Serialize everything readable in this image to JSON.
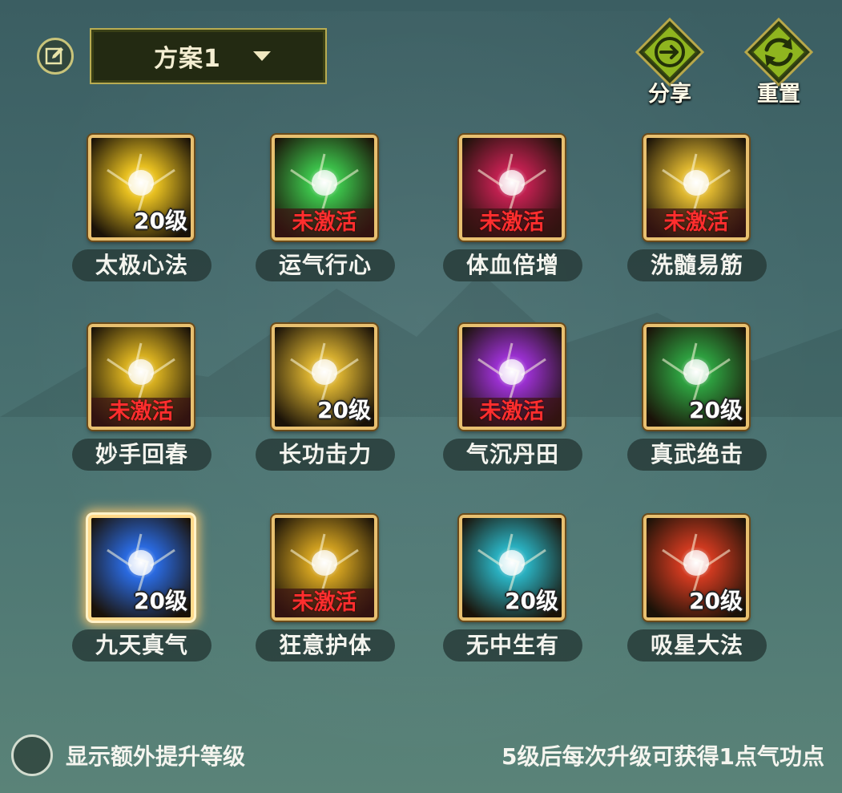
{
  "header": {
    "edit_icon": "edit-pencil-icon",
    "scheme_select": {
      "value": "方案1",
      "caret_icon": "chevron-down-icon"
    },
    "share_button": {
      "label": "分享",
      "icon": "share-arrow-icon"
    },
    "reset_button": {
      "label": "重置",
      "icon": "reset-cycle-icon"
    }
  },
  "skills": [
    {
      "name": "太极心法",
      "status": "20级",
      "active": true,
      "icon": "golden-lightning-orb-icon",
      "theme": "#e8c020",
      "selected": false
    },
    {
      "name": "运气行心",
      "status": "未激活",
      "active": false,
      "icon": "green-energy-burst-icon",
      "theme": "#3cc04a",
      "selected": false
    },
    {
      "name": "体血倍增",
      "status": "未激活",
      "active": false,
      "icon": "crimson-blade-icon",
      "theme": "#c02050",
      "selected": false
    },
    {
      "name": "洗髓易筋",
      "status": "未激活",
      "active": false,
      "icon": "golden-shield-strike-icon",
      "theme": "#e0b830",
      "selected": false
    },
    {
      "name": "妙手回春",
      "status": "未激活",
      "active": false,
      "icon": "golden-pillar-lightning-icon",
      "theme": "#d8b020",
      "selected": false
    },
    {
      "name": "长功击力",
      "status": "20级",
      "active": true,
      "icon": "golden-slash-icon",
      "theme": "#d8b030",
      "selected": false
    },
    {
      "name": "气沉丹田",
      "status": "未激活",
      "active": false,
      "icon": "purple-aura-body-icon",
      "theme": "#9a30d0",
      "selected": false
    },
    {
      "name": "真武绝击",
      "status": "20级",
      "active": true,
      "icon": "green-muscle-flex-icon",
      "theme": "#2ea040",
      "selected": false
    },
    {
      "name": "九天真气",
      "status": "20级",
      "active": true,
      "icon": "blue-crystal-shield-icon",
      "theme": "#2a6ae0",
      "selected": true
    },
    {
      "name": "狂意护体",
      "status": "未激活",
      "active": false,
      "icon": "golden-glow-shield-icon",
      "theme": "#d0a020",
      "selected": false
    },
    {
      "name": "无中生有",
      "status": "20级",
      "active": true,
      "icon": "cyan-swirl-shield-icon",
      "theme": "#2ab0c0",
      "selected": false
    },
    {
      "name": "吸星大法",
      "status": "20级",
      "active": true,
      "icon": "red-vortex-star-icon",
      "theme": "#d03a20",
      "selected": false
    }
  ],
  "footer": {
    "toggle_label": "显示额外提升等级",
    "toggle_checked": false,
    "hint": "5级后每次升级可获得1点气功点"
  }
}
